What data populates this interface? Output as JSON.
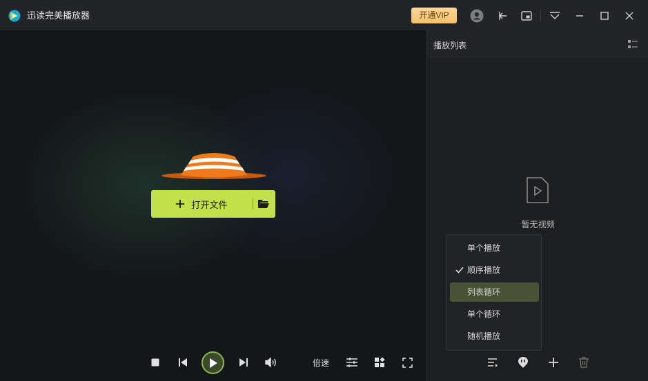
{
  "app": {
    "title": "迅读完美播放器",
    "vip_label": "开通VIP",
    "accent_color": "#c2e04a",
    "vip_color": "#f3c16e"
  },
  "titlebar_icons": [
    "user-icon",
    "pin-icon",
    "mini-window-icon",
    "dropdown-icon",
    "minimize-icon",
    "maximize-icon",
    "close-icon"
  ],
  "player": {
    "open_file_label": "打开文件",
    "speed_label": "倍速"
  },
  "playlist": {
    "title": "播放列表",
    "empty_text": "暂无视频",
    "play_modes": [
      {
        "label": "单个播放",
        "checked": false,
        "highlighted": false
      },
      {
        "label": "顺序播放",
        "checked": true,
        "highlighted": false
      },
      {
        "label": "列表循环",
        "checked": false,
        "highlighted": true
      },
      {
        "label": "单个循环",
        "checked": false,
        "highlighted": false
      },
      {
        "label": "随机播放",
        "checked": false,
        "highlighted": false
      }
    ]
  }
}
